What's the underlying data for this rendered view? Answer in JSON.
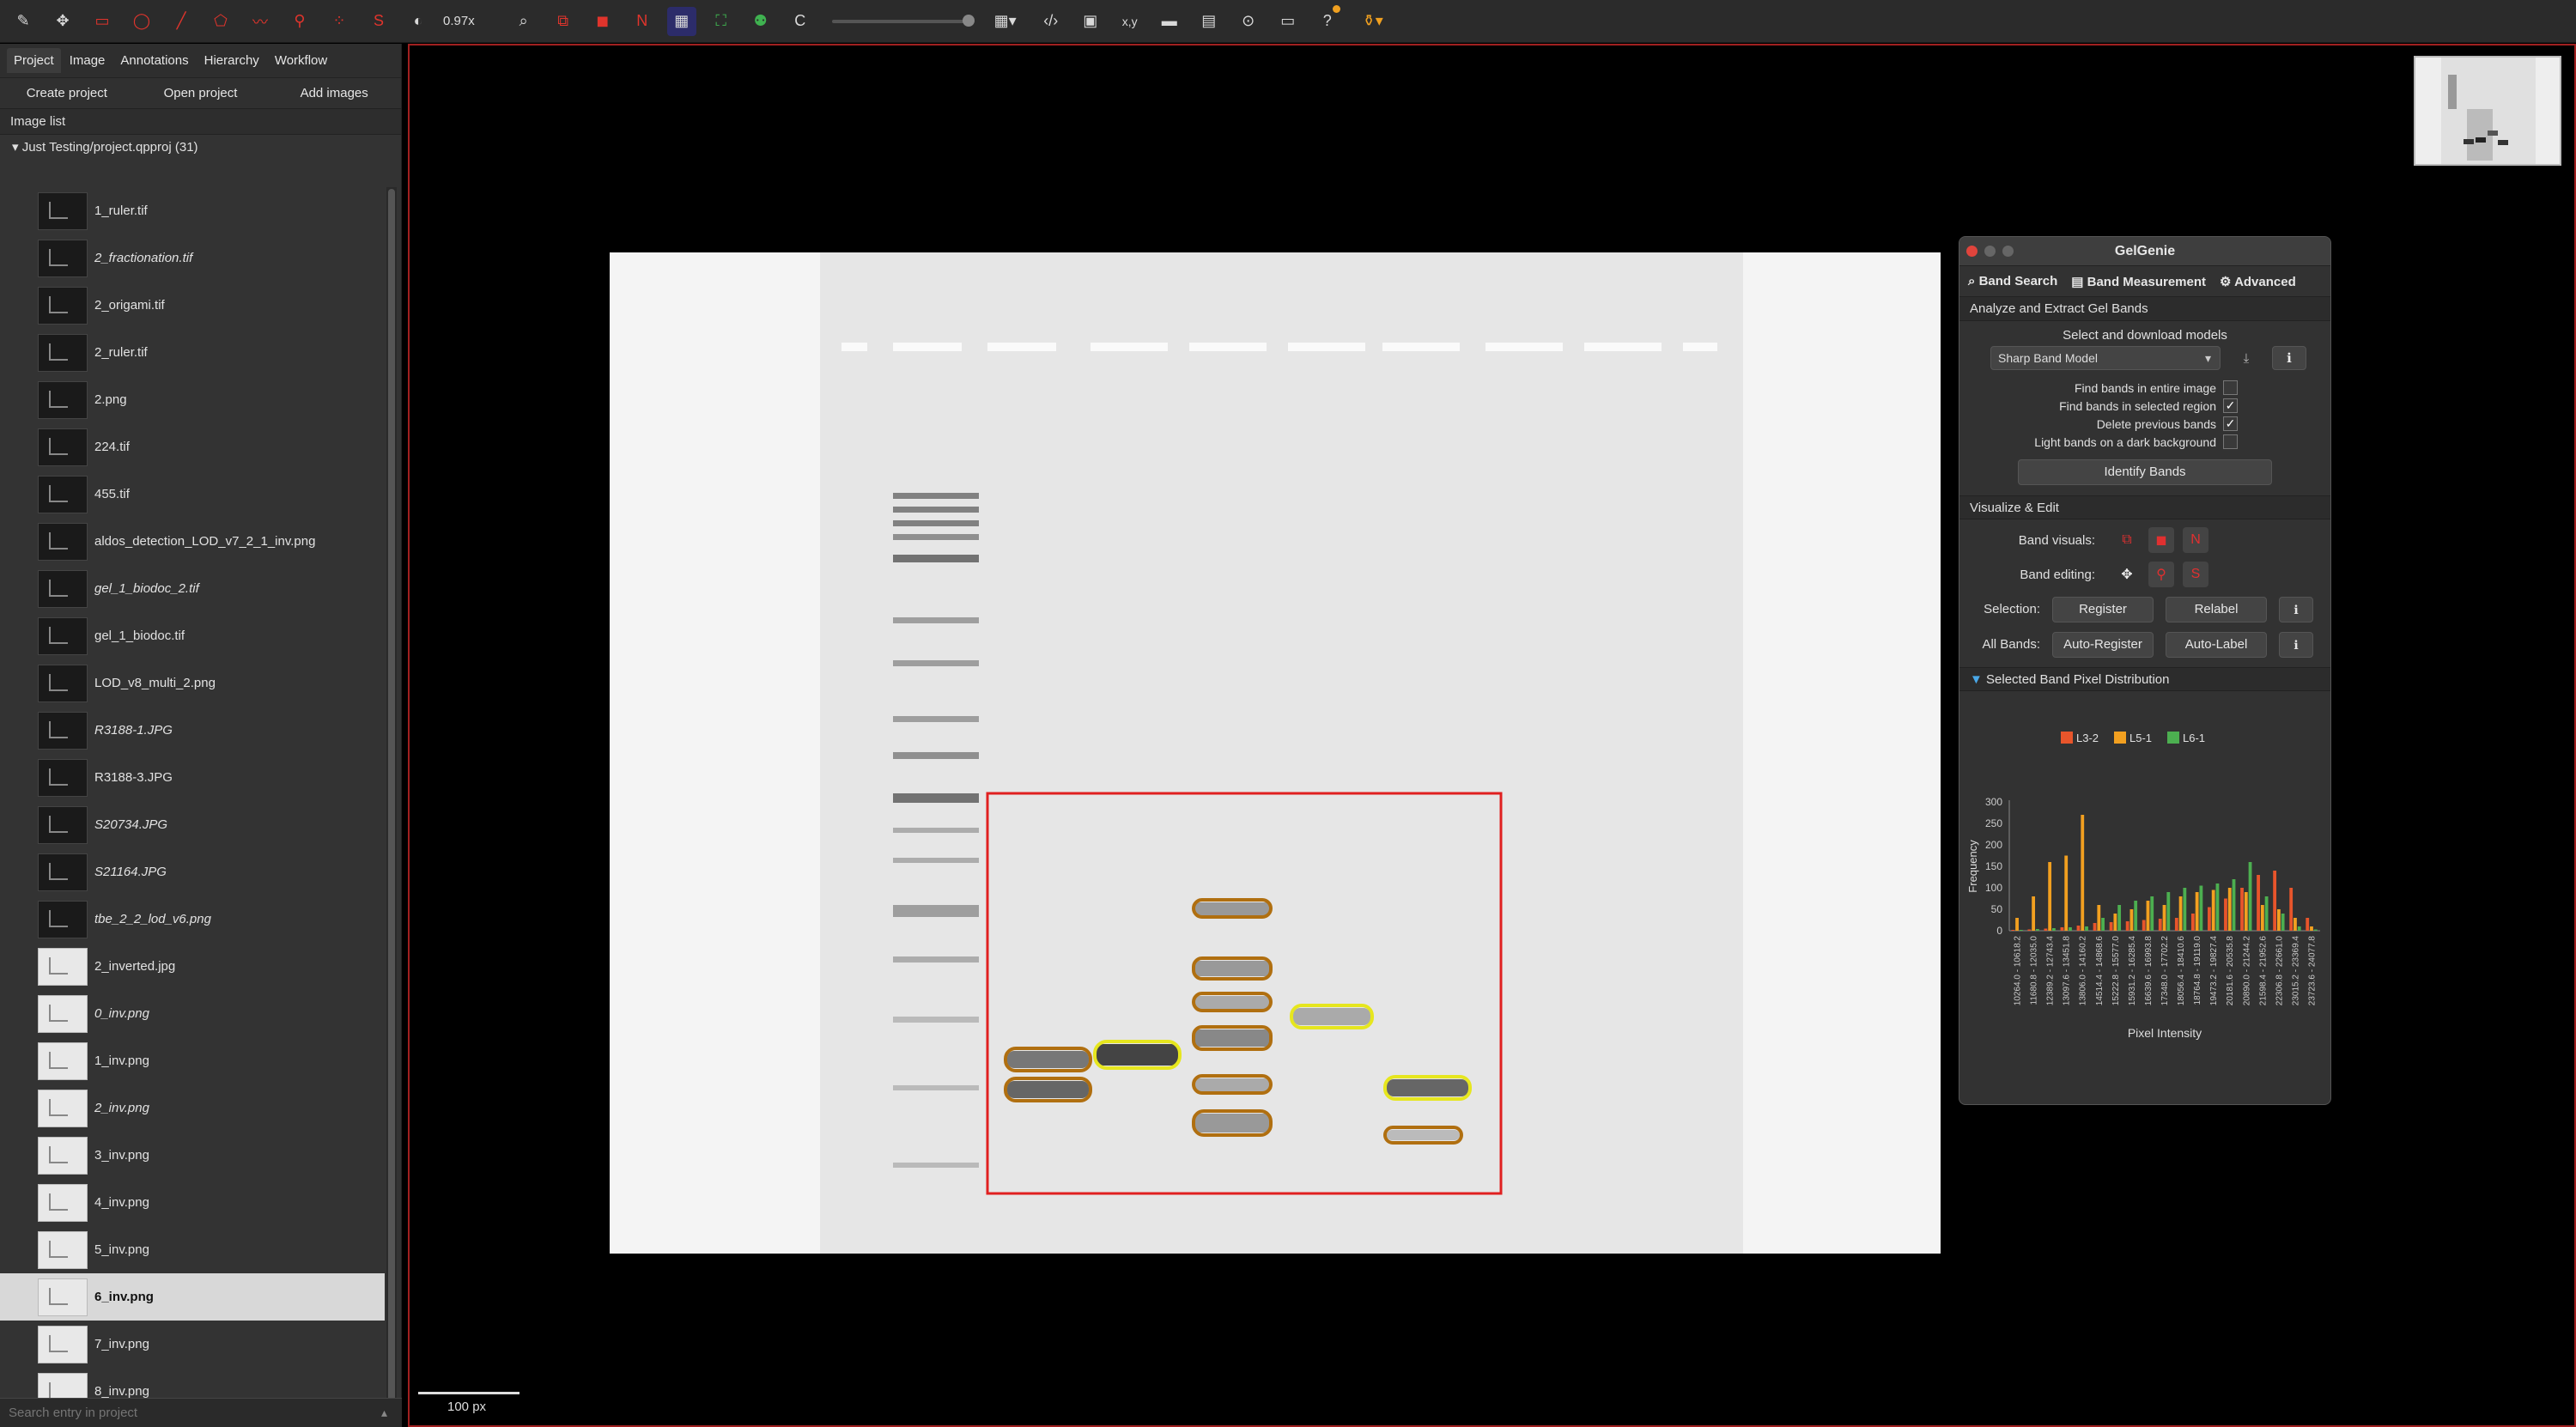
{
  "toolbar": {
    "zoom": "0.97x",
    "c_label": "C",
    "xy_label": "x,y"
  },
  "left": {
    "tabs": [
      "Project",
      "Image",
      "Annotations",
      "Hierarchy",
      "Workflow"
    ],
    "buttons": [
      "Create project",
      "Open project",
      "Add images"
    ],
    "list_header": "Image list",
    "project_root": "Just Testing/project.qpproj (31)",
    "images": [
      {
        "name": "1_ruler.tif",
        "italic": false,
        "light": false,
        "selected": false
      },
      {
        "name": "2_fractionation.tif",
        "italic": true,
        "light": false,
        "selected": false
      },
      {
        "name": "2_origami.tif",
        "italic": false,
        "light": false,
        "selected": false
      },
      {
        "name": "2_ruler.tif",
        "italic": false,
        "light": false,
        "selected": false
      },
      {
        "name": "2.png",
        "italic": false,
        "light": false,
        "selected": false
      },
      {
        "name": "224.tif",
        "italic": false,
        "light": false,
        "selected": false
      },
      {
        "name": "455.tif",
        "italic": false,
        "light": false,
        "selected": false
      },
      {
        "name": "aldos_detection_LOD_v7_2_1_inv.png",
        "italic": false,
        "light": false,
        "selected": false
      },
      {
        "name": "gel_1_biodoc_2.tif",
        "italic": true,
        "light": false,
        "selected": false
      },
      {
        "name": "gel_1_biodoc.tif",
        "italic": false,
        "light": false,
        "selected": false
      },
      {
        "name": "LOD_v8_multi_2.png",
        "italic": false,
        "light": false,
        "selected": false
      },
      {
        "name": "R3188-1.JPG",
        "italic": true,
        "light": false,
        "selected": false
      },
      {
        "name": "R3188-3.JPG",
        "italic": false,
        "light": false,
        "selected": false
      },
      {
        "name": "S20734.JPG",
        "italic": true,
        "light": false,
        "selected": false
      },
      {
        "name": "S21164.JPG",
        "italic": true,
        "light": false,
        "selected": false
      },
      {
        "name": "tbe_2_2_lod_v6.png",
        "italic": true,
        "light": false,
        "selected": false
      },
      {
        "name": "2_inverted.jpg",
        "italic": false,
        "light": true,
        "selected": false
      },
      {
        "name": "0_inv.png",
        "italic": true,
        "light": true,
        "selected": false
      },
      {
        "name": "1_inv.png",
        "italic": false,
        "light": true,
        "selected": false
      },
      {
        "name": "2_inv.png",
        "italic": true,
        "light": true,
        "selected": false
      },
      {
        "name": "3_inv.png",
        "italic": false,
        "light": true,
        "selected": false
      },
      {
        "name": "4_inv.png",
        "italic": false,
        "light": true,
        "selected": false
      },
      {
        "name": "5_inv.png",
        "italic": false,
        "light": true,
        "selected": false
      },
      {
        "name": "6_inv.png",
        "italic": false,
        "light": true,
        "selected": true
      },
      {
        "name": "7_inv.png",
        "italic": false,
        "light": true,
        "selected": false
      },
      {
        "name": "8_inv.png",
        "italic": false,
        "light": true,
        "selected": false
      }
    ],
    "search_placeholder": "Search entry in project"
  },
  "viewer": {
    "scale_label": "100 px"
  },
  "gelgenie": {
    "title": "GelGenie",
    "tabs": [
      "Band Search",
      "Band Measurement",
      "Advanced"
    ],
    "section_analyze": "Analyze and Extract Gel Bands",
    "select_models": "Select and download models",
    "model_value": "Sharp Band Model",
    "checks": [
      {
        "label": "Find bands in entire image",
        "checked": false
      },
      {
        "label": "Find bands in selected region",
        "checked": true
      },
      {
        "label": "Delete previous bands",
        "checked": true
      },
      {
        "label": "Light bands on a dark background",
        "checked": false
      }
    ],
    "identify": "Identify Bands",
    "section_visualize": "Visualize & Edit",
    "band_visuals": "Band visuals:",
    "band_editing": "Band editing:",
    "selection_label": "Selection:",
    "register": "Register",
    "relabel": "Relabel",
    "all_bands_label": "All Bands:",
    "auto_register": "Auto-Register",
    "auto_label": "Auto-Label",
    "dist_header": "Selected Band Pixel Distribution"
  },
  "chart_data": {
    "type": "bar",
    "xlabel": "Pixel Intensity",
    "ylabel": "Frequency",
    "ylim": [
      0,
      300
    ],
    "yticks": [
      0,
      50,
      100,
      150,
      200,
      250,
      300
    ],
    "legend_position": "top-center",
    "categories": [
      "10264.0 - 10618.2",
      "11680.8 - 12035.0",
      "12389.2 - 12743.4",
      "13097.6 - 13451.8",
      "13806.0 - 14160.2",
      "14514.4 - 14868.6",
      "15222.8 - 15577.0",
      "15931.2 - 16285.4",
      "16639.6 - 16993.8",
      "17348.0 - 17702.2",
      "18056.4 - 18410.6",
      "18764.8 - 19119.0",
      "19473.2 - 19827.4",
      "20181.6 - 20535.8",
      "20890.0 - 21244.2",
      "21598.4 - 21952.6",
      "22306.8 - 22661.0",
      "23015.2 - 23369.4",
      "23723.6 - 24077.8"
    ],
    "series": [
      {
        "name": "L3-2",
        "color": "#e8552b",
        "values": [
          2,
          3,
          5,
          8,
          12,
          18,
          20,
          22,
          25,
          28,
          30,
          40,
          55,
          75,
          100,
          130,
          140,
          100,
          30
        ]
      },
      {
        "name": "L5-1",
        "color": "#f2a020",
        "values": [
          30,
          80,
          160,
          175,
          270,
          60,
          40,
          50,
          70,
          60,
          80,
          90,
          95,
          100,
          90,
          60,
          50,
          30,
          10
        ]
      },
      {
        "name": "L6-1",
        "color": "#4caf50",
        "values": [
          2,
          4,
          6,
          8,
          10,
          30,
          60,
          70,
          80,
          90,
          100,
          105,
          110,
          120,
          160,
          80,
          40,
          10,
          3
        ]
      }
    ]
  }
}
